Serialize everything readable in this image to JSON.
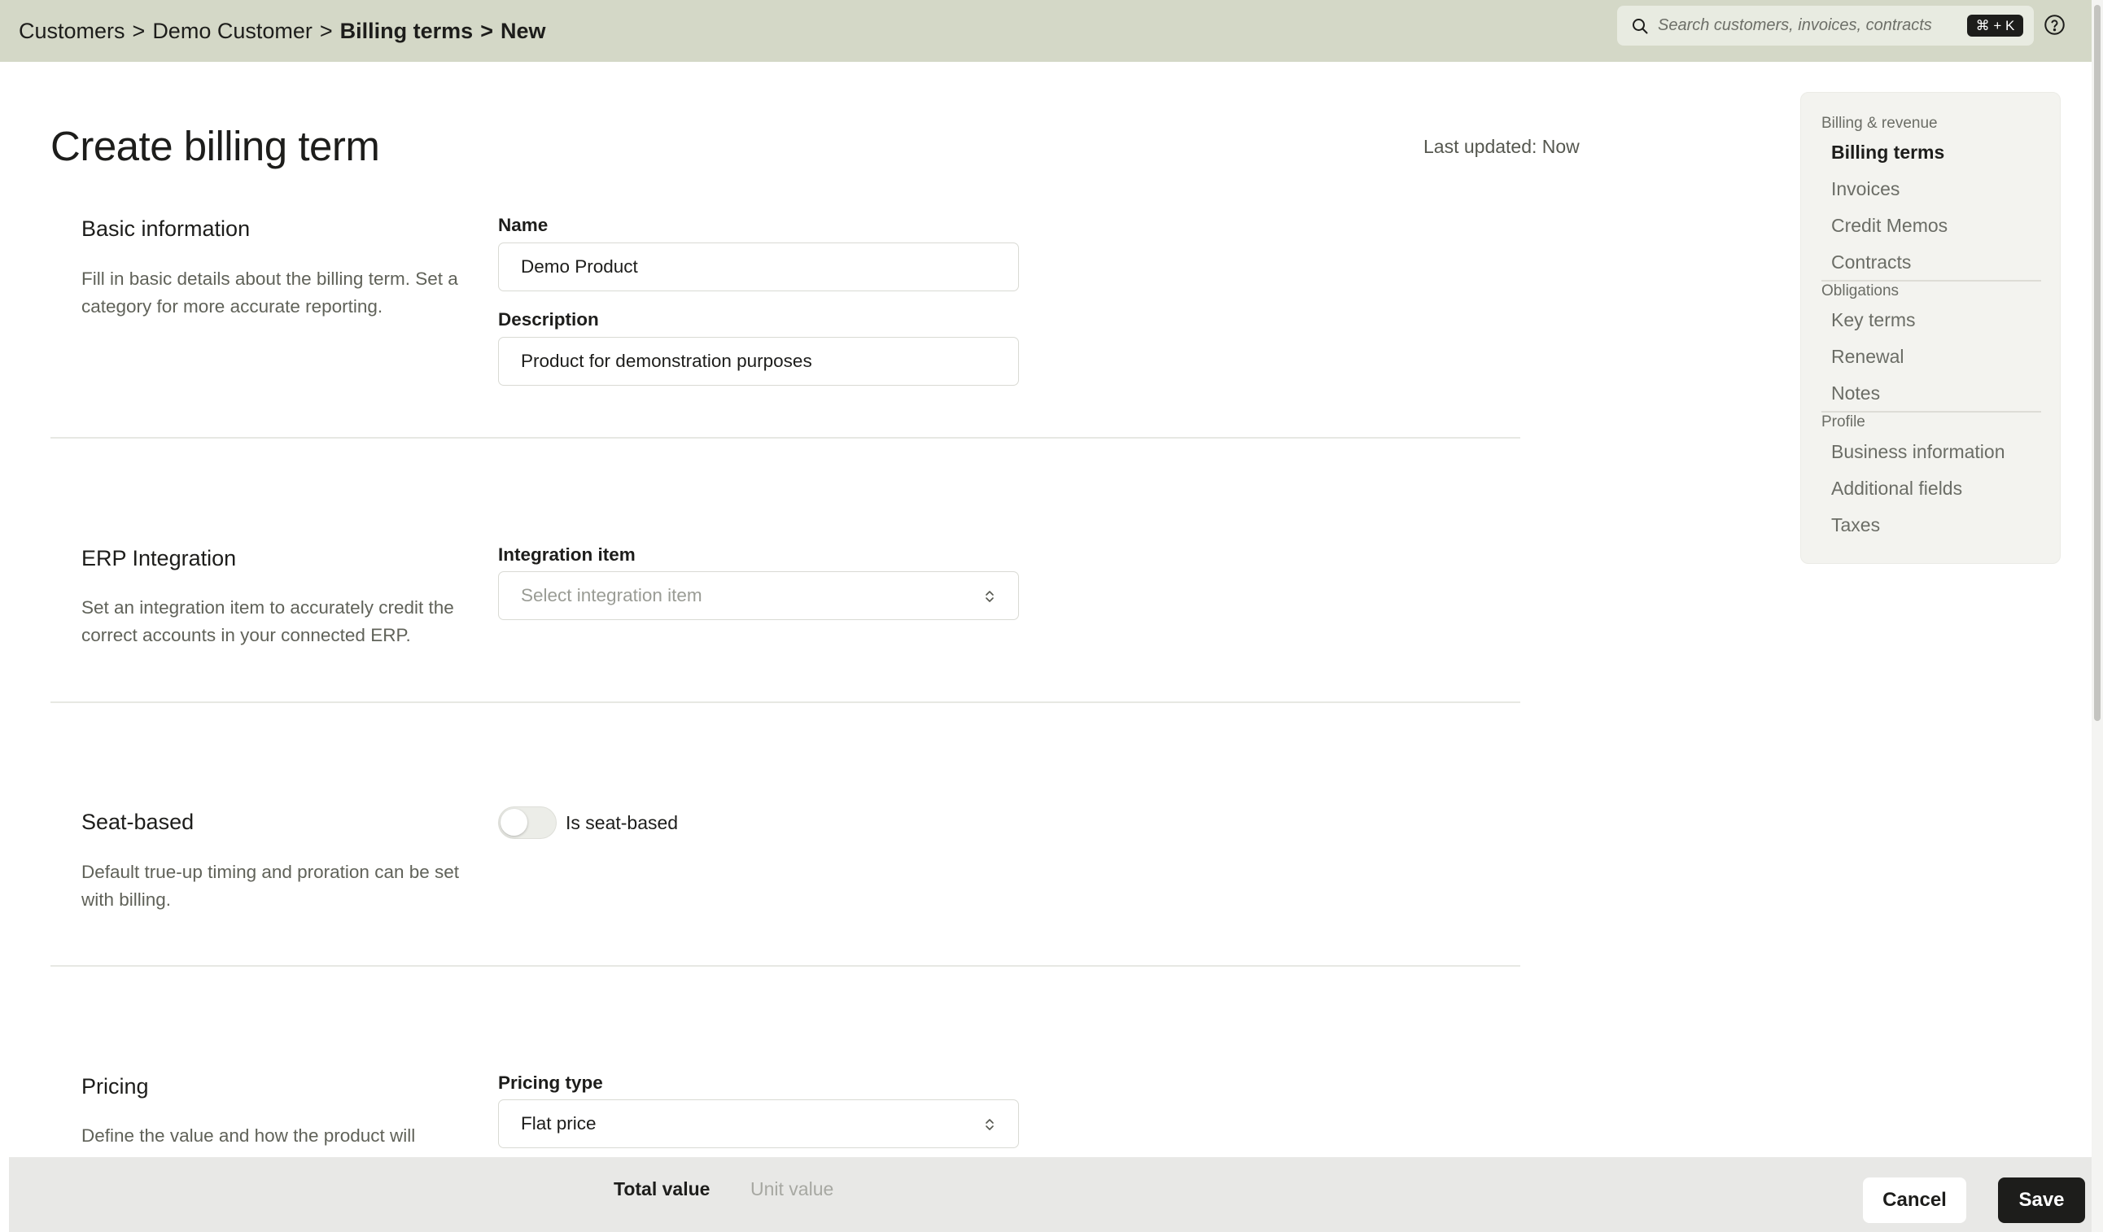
{
  "breadcrumb": {
    "items": [
      "Customers",
      "Demo Customer",
      "Billing terms",
      "New"
    ],
    "separator": ">"
  },
  "search": {
    "placeholder": "Search customers, invoices, contracts",
    "shortcut": "⌘ + K"
  },
  "page": {
    "title": "Create billing term",
    "last_updated": "Last updated: Now"
  },
  "sections": {
    "basic": {
      "title": "Basic information",
      "description": "Fill in basic details about the billing term. Set a category for more accurate reporting.",
      "name_label": "Name",
      "name_value": "Demo Product",
      "description_label": "Description",
      "description_value": "Product for demonstration purposes"
    },
    "erp": {
      "title": "ERP Integration",
      "description": "Set an integration item to accurately credit the correct accounts in your connected ERP.",
      "integration_label": "Integration item",
      "integration_placeholder": "Select integration item"
    },
    "seat": {
      "title": "Seat-based",
      "description": "Default true-up timing and proration can be set with billing.",
      "toggle_label": "Is seat-based",
      "toggle_on": false
    },
    "pricing": {
      "title": "Pricing",
      "description": "Define the value and how the product will",
      "pricing_type_label": "Pricing type",
      "pricing_type_value": "Flat price"
    }
  },
  "rightnav": {
    "groups": [
      {
        "label": "Billing & revenue",
        "items": [
          "Billing terms",
          "Invoices",
          "Credit Memos",
          "Contracts"
        ]
      },
      {
        "label": "Obligations",
        "items": [
          "Key terms",
          "Renewal",
          "Notes"
        ]
      },
      {
        "label": "Profile",
        "items": [
          "Business information",
          "Additional fields",
          "Taxes"
        ]
      }
    ],
    "active_item": "Billing terms"
  },
  "footer": {
    "tab_total": "Total value",
    "tab_unit": "Unit value",
    "cancel_label": "Cancel",
    "save_label": "Save"
  },
  "colors": {
    "topbar": "#d4d8c7",
    "primary_button": "#1d1d1b",
    "bottombar": "#e8e8e6"
  }
}
